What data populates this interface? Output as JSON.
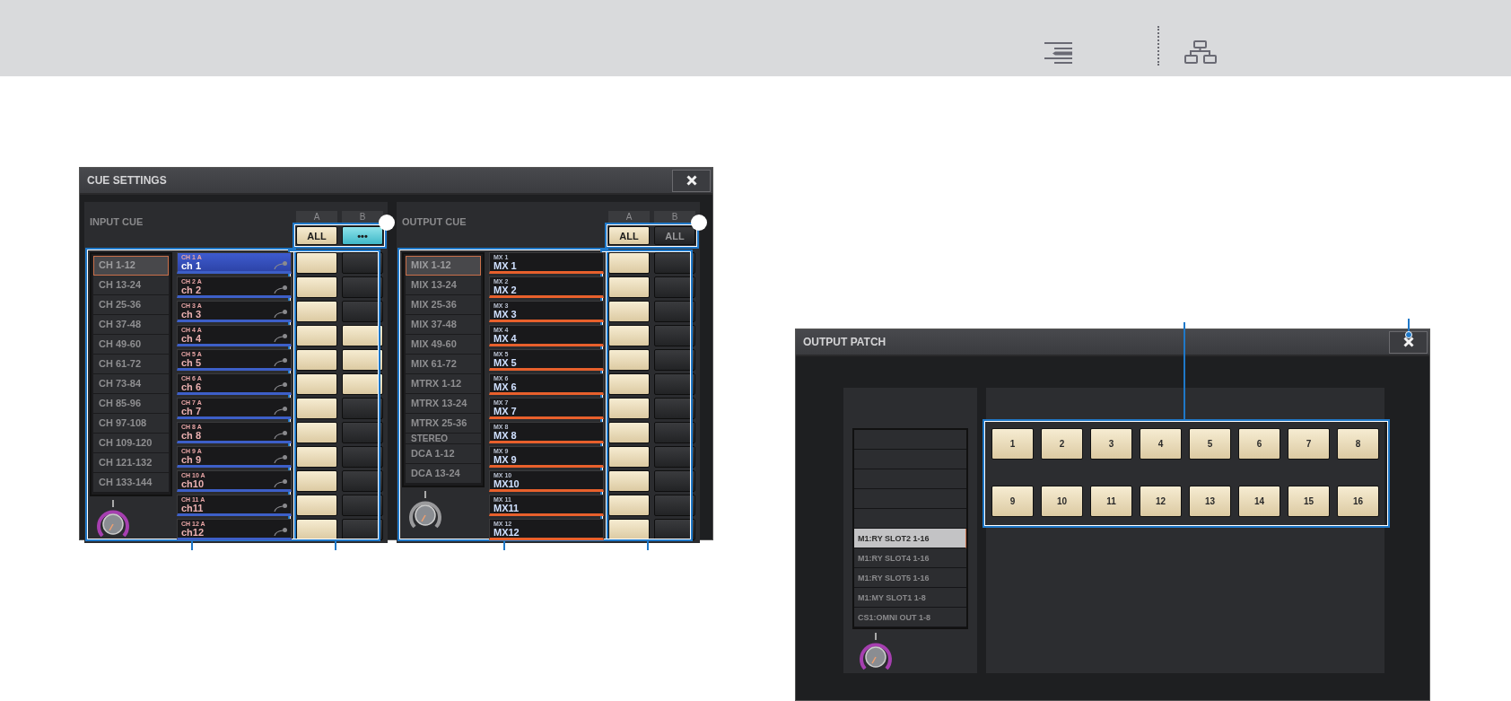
{
  "cue_settings": {
    "title": "CUE SETTINGS",
    "sections": [
      {
        "kind": "input",
        "label": "INPUT CUE",
        "columns": [
          "A",
          "B"
        ],
        "all_buttons": [
          {
            "label": "ALL",
            "on": true,
            "partial": false
          },
          {
            "label": "•••",
            "on": true,
            "partial": true
          }
        ],
        "banks": [
          {
            "label": "CH 1-12",
            "selected": true,
            "kind": "bank"
          },
          {
            "label": "CH 13-24",
            "selected": false,
            "kind": "bank"
          },
          {
            "label": "CH 25-36",
            "selected": false,
            "kind": "bank"
          },
          {
            "label": "CH 37-48",
            "selected": false,
            "kind": "bank"
          },
          {
            "label": "CH 49-60",
            "selected": false,
            "kind": "bank"
          },
          {
            "label": "CH 61-72",
            "selected": false,
            "kind": "bank"
          },
          {
            "label": "CH 73-84",
            "selected": false,
            "kind": "bank"
          },
          {
            "label": "CH 85-96",
            "selected": false,
            "kind": "bank"
          },
          {
            "label": "CH 97-108",
            "selected": false,
            "kind": "bank"
          },
          {
            "label": "CH 109-120",
            "selected": false,
            "kind": "bank"
          },
          {
            "label": "CH 121-132",
            "selected": false,
            "kind": "bank"
          },
          {
            "label": "CH 133-144",
            "selected": false,
            "kind": "bank"
          }
        ],
        "channels": [
          {
            "id": "CH 1 A",
            "name": "ch 1",
            "selected": true,
            "cue_a": true,
            "cue_b": false
          },
          {
            "id": "CH 2 A",
            "name": "ch 2",
            "selected": false,
            "cue_a": true,
            "cue_b": false
          },
          {
            "id": "CH 3 A",
            "name": "ch 3",
            "selected": false,
            "cue_a": true,
            "cue_b": false
          },
          {
            "id": "CH 4 A",
            "name": "ch 4",
            "selected": false,
            "cue_a": true,
            "cue_b": true
          },
          {
            "id": "CH 5 A",
            "name": "ch 5",
            "selected": false,
            "cue_a": true,
            "cue_b": true
          },
          {
            "id": "CH 6 A",
            "name": "ch 6",
            "selected": false,
            "cue_a": true,
            "cue_b": true
          },
          {
            "id": "CH 7 A",
            "name": "ch 7",
            "selected": false,
            "cue_a": true,
            "cue_b": false
          },
          {
            "id": "CH 8 A",
            "name": "ch 8",
            "selected": false,
            "cue_a": true,
            "cue_b": false
          },
          {
            "id": "CH 9 A",
            "name": "ch 9",
            "selected": false,
            "cue_a": true,
            "cue_b": false
          },
          {
            "id": "CH 10 A",
            "name": "ch10",
            "selected": false,
            "cue_a": true,
            "cue_b": false
          },
          {
            "id": "CH 11 A",
            "name": "ch11",
            "selected": false,
            "cue_a": true,
            "cue_b": false
          },
          {
            "id": "CH 12 A",
            "name": "ch12",
            "selected": false,
            "cue_a": true,
            "cue_b": false
          }
        ]
      },
      {
        "kind": "output",
        "label": "OUTPUT CUE",
        "columns": [
          "A",
          "B"
        ],
        "all_buttons": [
          {
            "label": "ALL",
            "on": true,
            "partial": false
          },
          {
            "label": "ALL",
            "on": false,
            "partial": false
          }
        ],
        "banks": [
          {
            "label": "MIX 1-12",
            "selected": true,
            "kind": "bank"
          },
          {
            "label": "MIX 13-24",
            "selected": false,
            "kind": "bank"
          },
          {
            "label": "MIX 25-36",
            "selected": false,
            "kind": "bank"
          },
          {
            "label": "MIX 37-48",
            "selected": false,
            "kind": "bank"
          },
          {
            "label": "MIX 49-60",
            "selected": false,
            "kind": "bank"
          },
          {
            "label": "MIX 61-72",
            "selected": false,
            "kind": "bank"
          },
          {
            "label": "MTRX 1-12",
            "selected": false,
            "kind": "bank"
          },
          {
            "label": "MTRX 13-24",
            "selected": false,
            "kind": "bank"
          },
          {
            "label": "MTRX 25-36",
            "selected": false,
            "kind": "bank"
          },
          {
            "label": "STEREO",
            "selected": false,
            "kind": "short"
          },
          {
            "label": "DCA 1-12",
            "selected": false,
            "kind": "bank"
          },
          {
            "label": "DCA 13-24",
            "selected": false,
            "kind": "bank"
          }
        ],
        "channels": [
          {
            "id": "MX 1",
            "name": "MX 1",
            "selected": false,
            "cue_a": true,
            "cue_b": false
          },
          {
            "id": "MX 2",
            "name": "MX 2",
            "selected": false,
            "cue_a": true,
            "cue_b": false
          },
          {
            "id": "MX 3",
            "name": "MX 3",
            "selected": false,
            "cue_a": true,
            "cue_b": false
          },
          {
            "id": "MX 4",
            "name": "MX 4",
            "selected": false,
            "cue_a": true,
            "cue_b": false
          },
          {
            "id": "MX 5",
            "name": "MX 5",
            "selected": false,
            "cue_a": true,
            "cue_b": false
          },
          {
            "id": "MX 6",
            "name": "MX 6",
            "selected": false,
            "cue_a": true,
            "cue_b": false
          },
          {
            "id": "MX 7",
            "name": "MX 7",
            "selected": false,
            "cue_a": true,
            "cue_b": false
          },
          {
            "id": "MX 8",
            "name": "MX 8",
            "selected": false,
            "cue_a": true,
            "cue_b": false
          },
          {
            "id": "MX 9",
            "name": "MX 9",
            "selected": false,
            "cue_a": true,
            "cue_b": false
          },
          {
            "id": "MX 10",
            "name": "MX10",
            "selected": false,
            "cue_a": true,
            "cue_b": false
          },
          {
            "id": "MX 11",
            "name": "MX11",
            "selected": false,
            "cue_a": true,
            "cue_b": false
          },
          {
            "id": "MX 12",
            "name": "MX12",
            "selected": false,
            "cue_a": true,
            "cue_b": false
          }
        ]
      }
    ]
  },
  "output_patch": {
    "title": "OUTPUT PATCH",
    "slots": [
      {
        "selected": false
      },
      {
        "selected": false
      },
      {
        "selected": false
      },
      {
        "selected": false
      },
      {
        "selected": false
      },
      {
        "label": "M1:RY SLOT2 1-16",
        "selected": true
      },
      {
        "label": "M1:RY SLOT4 1-16",
        "selected": false
      },
      {
        "label": "M1:RY SLOT5 1-16",
        "selected": false
      },
      {
        "label": "M1:MY SLOT1 1-8",
        "selected": false
      },
      {
        "label": "CS1:OMNI OUT 1-8",
        "selected": false
      }
    ],
    "ports": [
      {
        "label": "1",
        "on": true
      },
      {
        "label": "2",
        "on": true
      },
      {
        "label": "3",
        "on": true
      },
      {
        "label": "4",
        "on": true
      },
      {
        "label": "5",
        "on": true
      },
      {
        "label": "6",
        "on": true
      },
      {
        "label": "7",
        "on": true
      },
      {
        "label": "8",
        "on": true
      },
      {
        "label": "9",
        "on": true
      },
      {
        "label": "10",
        "on": true
      },
      {
        "label": "11",
        "on": true
      },
      {
        "label": "12",
        "on": true
      },
      {
        "label": "13",
        "on": true
      },
      {
        "label": "14",
        "on": true
      },
      {
        "label": "15",
        "on": true
      },
      {
        "label": "16",
        "on": true
      }
    ]
  }
}
